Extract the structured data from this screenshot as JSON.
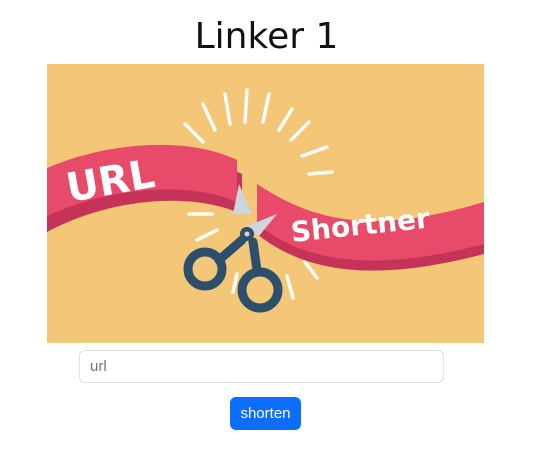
{
  "page": {
    "title": "Linker 1"
  },
  "hero": {
    "ribbon_left_text": "URL",
    "ribbon_right_text": "Shortner",
    "colors": {
      "background": "#f4c677",
      "ribbon": "#e84a6a",
      "ribbon_shadow": "#c53458",
      "scissors_handle": "#2e4f6b",
      "scissors_blade": "#cfd5dc",
      "rays": "#ffffff"
    }
  },
  "form": {
    "url_placeholder": "url",
    "url_value": "",
    "shorten_label": "shorten"
  },
  "colors": {
    "button": "#0d6efd",
    "input_border": "#dee2e6"
  }
}
